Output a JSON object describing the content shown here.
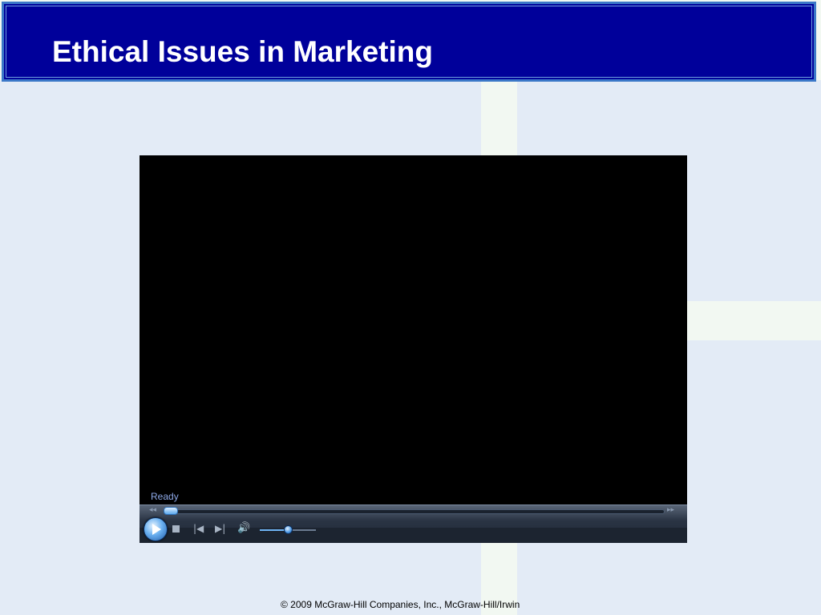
{
  "slide": {
    "title": "Ethical Issues in Marketing",
    "footer": "© 2009 McGraw-Hill Companies, Inc., McGraw-Hill/Irwin"
  },
  "player": {
    "status": "Ready",
    "seek_position": 0.0,
    "volume_level": 0.5,
    "icons": {
      "play": "play-icon",
      "stop": "stop-icon",
      "previous": "previous-icon",
      "next": "next-icon",
      "volume": "volume-icon",
      "rewind": "rewind-icon",
      "fast_forward": "fast-forward-icon"
    }
  },
  "colors": {
    "title_bar": "#00009a",
    "title_border": "#3b78c8",
    "title_text": "#ffffff",
    "player_background": "#000000",
    "status_text": "#8ea9e8",
    "accent": "#5aa8ec"
  }
}
